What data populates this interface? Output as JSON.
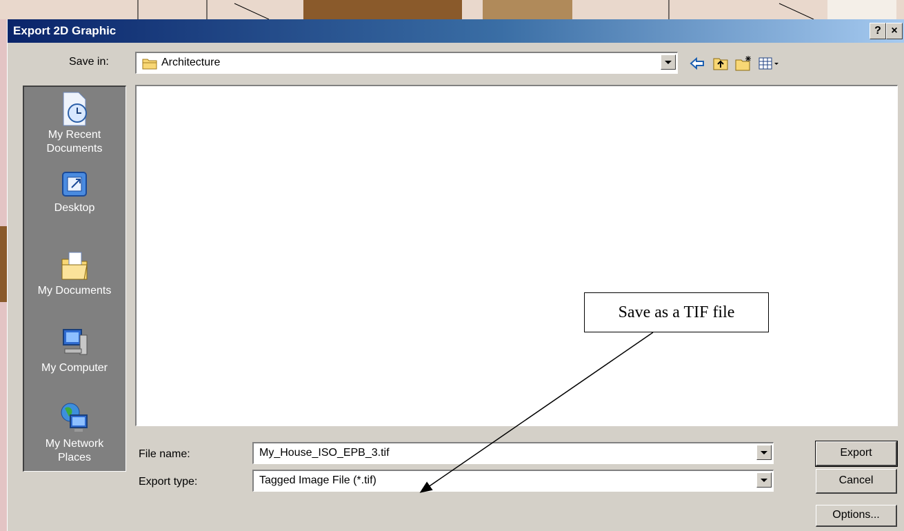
{
  "dialog": {
    "title": "Export 2D Graphic",
    "help_label": "?",
    "close_label": "×"
  },
  "save_in": {
    "label": "Save in:",
    "value": "Architecture"
  },
  "toolbar_icons": [
    "back-arrow-icon",
    "up-folder-icon",
    "new-folder-icon",
    "view-menu-icon"
  ],
  "places": [
    {
      "label": "My Recent\nDocuments",
      "icon": "recent-documents-icon"
    },
    {
      "label": "Desktop",
      "icon": "desktop-icon"
    },
    {
      "label": "My Documents",
      "icon": "my-documents-icon"
    },
    {
      "label": "My Computer",
      "icon": "my-computer-icon"
    },
    {
      "label": "My Network\nPlaces",
      "icon": "network-places-icon"
    }
  ],
  "file_name": {
    "label": "File name:",
    "value": "My_House_ISO_EPB_3.tif"
  },
  "export_type": {
    "label": "Export type:",
    "value": "Tagged Image File (*.tif)"
  },
  "buttons": {
    "export": "Export",
    "cancel": "Cancel",
    "options": "Options..."
  },
  "annotation": {
    "text": "Save as a TIF file"
  },
  "colors": {
    "title_gradient_start": "#0a246a",
    "title_gradient_end": "#a6caf0",
    "dialog_face": "#d4d0c8",
    "places_bar": "#808080"
  }
}
